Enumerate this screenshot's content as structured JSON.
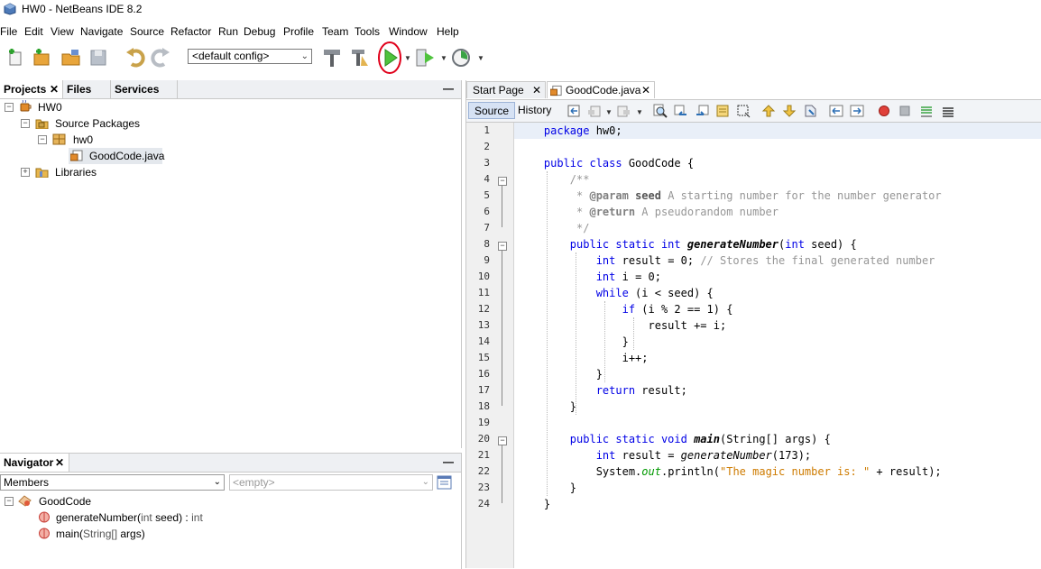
{
  "window": {
    "title": "HW0 - NetBeans IDE 8.2"
  },
  "menu": [
    "File",
    "Edit",
    "View",
    "Navigate",
    "Source",
    "Refactor",
    "Run",
    "Debug",
    "Profile",
    "Team",
    "Tools",
    "Window",
    "Help"
  ],
  "toolbar": {
    "config_value": "<default config>"
  },
  "projects_panel": {
    "tabs": [
      "Projects",
      "Files",
      "Services"
    ],
    "tree": {
      "project": "HW0",
      "source_packages": "Source Packages",
      "package": "hw0",
      "file": "GoodCode.java",
      "libraries": "Libraries"
    }
  },
  "navigator": {
    "title": "Navigator",
    "filter": "Members",
    "secondary": "<empty>",
    "class_name": "GoodCode",
    "members": [
      {
        "name": "generateNumber(",
        "param_type": "int",
        "param_rest": " seed) : ",
        "return_type": "int"
      },
      {
        "name": "main(",
        "param_type": "String[]",
        "param_rest": " args)",
        "return_type": ""
      }
    ]
  },
  "editor": {
    "tabs": [
      "Start Page",
      "GoodCode.java"
    ],
    "view_buttons": [
      "Source",
      "History"
    ],
    "line_numbers": [
      "1",
      "2",
      "3",
      "4",
      "5",
      "6",
      "7",
      "8",
      "9",
      "10",
      "11",
      "12",
      "13",
      "14",
      "15",
      "16",
      "17",
      "18",
      "19",
      "20",
      "21",
      "22",
      "23",
      "24"
    ],
    "code": {
      "l1_kw": "package",
      "l1_rest": " hw0;",
      "l3_kw": "public class",
      "l3_rest": " GoodCode {",
      "l4": "/**",
      "l5_a": " * ",
      "l5_tag": "@param",
      "l5_b": " seed",
      "l5_c": " A starting number for the number generator",
      "l6_a": " * ",
      "l6_tag": "@return",
      "l6_b": " A pseudorandom number",
      "l7": " */",
      "l8_kw": "public static int",
      "l8_name": "generateNumber",
      "l8_p": "(",
      "l8_kw2": "int",
      "l8_rest": " seed) {",
      "l9_kw": "int",
      "l9_rest": " result = 0; ",
      "l9_cm": "// Stores the final generated number",
      "l10_kw": "int",
      "l10_rest": " i = 0;",
      "l11_kw": "while",
      "l11_rest": " (i < seed) {",
      "l12_kw": "if",
      "l12_rest": " (i % 2 == 1) {",
      "l13": "result += i;",
      "l14": "}",
      "l15": "i++;",
      "l16": "}",
      "l17_kw": "return",
      "l17_rest": " result;",
      "l18": "}",
      "l20_kw": "public static void",
      "l20_name": "main",
      "l20_rest": "(String[] args) {",
      "l21_kw": "int",
      "l21_a": " result = ",
      "l21_call": "generateNumber",
      "l21_b": "(173);",
      "l22_a": "System.",
      "l22_fld": "out",
      "l22_b": ".println(",
      "l22_str": "\"The magic number is: \"",
      "l22_c": " + result);",
      "l23": "}",
      "l24": "}"
    }
  },
  "colors": {
    "keyword": "#0000e6",
    "comment": "#969696",
    "string": "#ce7b00",
    "run_highlight": "#e0001a"
  }
}
